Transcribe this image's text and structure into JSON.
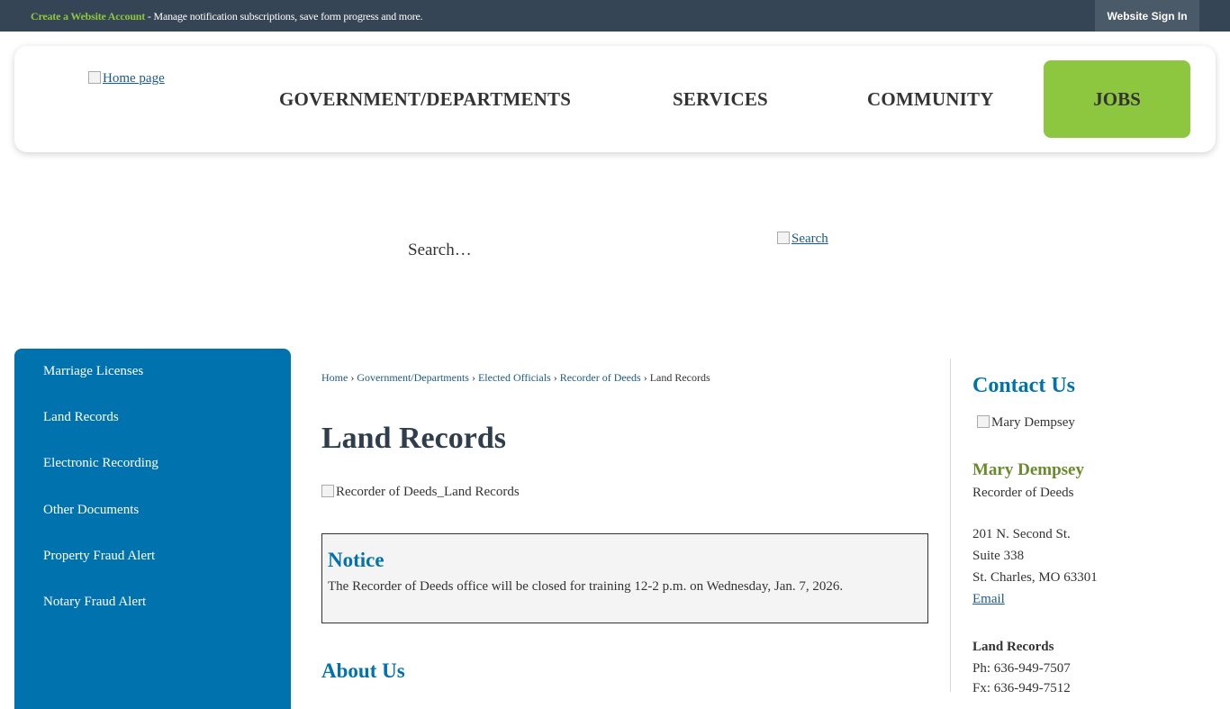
{
  "topbar": {
    "create_link": "Create a Website Account",
    "message": " - Manage notification subscriptions, save form progress and more.",
    "signin": "Website Sign In"
  },
  "header": {
    "logo_alt": "Home page",
    "nav": {
      "government": "GOVERNMENT/DEPARTMENTS",
      "services": "SERVICES",
      "community": "COMMUNITY",
      "jobs": "JOBS"
    },
    "accent_color": "#8dc63f"
  },
  "search": {
    "placeholder": "Search…",
    "button_alt": "Search"
  },
  "sidebar": {
    "color": "#0072ae",
    "items": [
      {
        "label": "Marriage Licenses"
      },
      {
        "label": "Land Records"
      },
      {
        "label": "Electronic Recording"
      },
      {
        "label": "Other Documents"
      },
      {
        "label": "Property Fraud Alert"
      },
      {
        "label": "Notary Fraud Alert"
      }
    ]
  },
  "breadcrumb": {
    "items": [
      "Home",
      "Government/Departments",
      "Elected Officials",
      "Recorder of Deeds"
    ],
    "current": "Land Records"
  },
  "main": {
    "title": "Land Records",
    "image_alt": "Recorder of Deeds_Land Records",
    "notice": {
      "heading": "Notice",
      "text": "The Recorder of Deeds office will be closed for training 12-2 p.m. on Wednesday, Jan. 7, 2026."
    },
    "about_heading": "About Us"
  },
  "contact": {
    "heading": "Contact Us",
    "image_alt": "Mary Dempsey",
    "name": "Mary Dempsey",
    "role": "Recorder of Deeds",
    "address1": "201 N. Second St.",
    "address2": "Suite 338",
    "address3": "St. Charles, MO 63301",
    "email": "Email",
    "dept": "Land Records",
    "phone": "Ph: 636-949-7507",
    "fax": "Fx: 636-949-7512"
  }
}
